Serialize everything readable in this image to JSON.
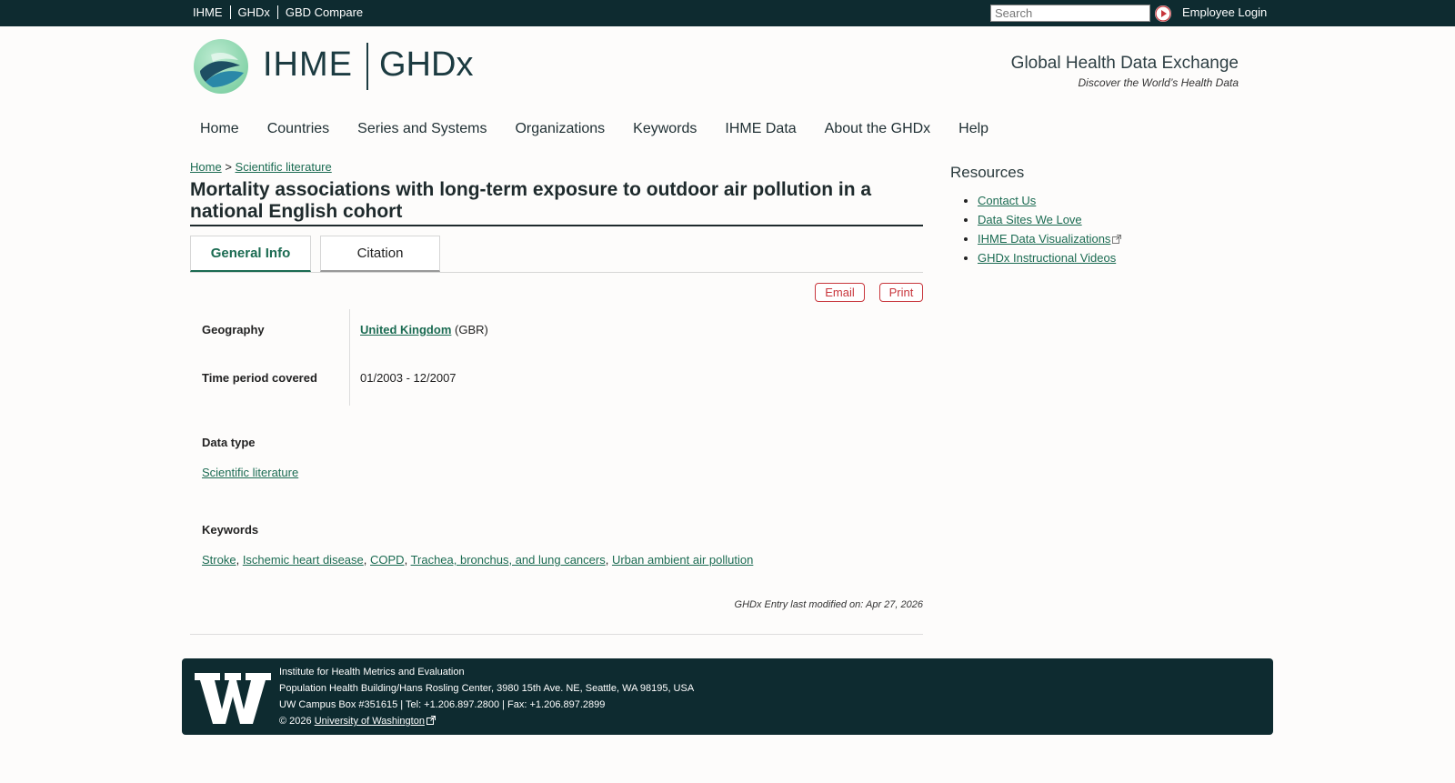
{
  "topbar": {
    "links": [
      "IHME",
      "GHDx",
      "GBD Compare"
    ],
    "search_placeholder": "Search",
    "employee_login": "Employee Login"
  },
  "header": {
    "brand_left": "IHME",
    "brand_right": "GHDx",
    "tagline_title": "Global Health Data Exchange",
    "tagline_sub": "Discover the World’s Health Data"
  },
  "nav": [
    "Home",
    "Countries",
    "Series and Systems",
    "Organizations",
    "Keywords",
    "IHME Data",
    "About the GHDx",
    "Help"
  ],
  "breadcrumb": {
    "home": "Home",
    "sep": ">",
    "current": "Scientific literature"
  },
  "title": "Mortality associations with long-term exposure to outdoor air pollution in a national English cohort",
  "tabs": {
    "general": "General Info",
    "citation": "Citation"
  },
  "actions": {
    "email": "Email",
    "print": "Print"
  },
  "info": {
    "geography_label": "Geography",
    "geography_link": "United Kingdom",
    "geography_code": "(GBR)",
    "time_label": "Time period covered",
    "time_value": "01/2003 - 12/2007",
    "datatype_label": "Data type",
    "datatype_value": "Scientific literature",
    "keywords_label": "Keywords",
    "keywords": [
      "Stroke",
      "Ischemic heart disease",
      "COPD",
      "Trachea, bronchus, and lung cancers",
      "Urban ambient air pollution"
    ]
  },
  "modified": "GHDx Entry last modified on: Apr 27, 2026",
  "resources": {
    "title": "Resources",
    "items": [
      "Contact Us",
      "Data Sites We Love",
      "IHME Data Visualizations",
      "GHDx Instructional Videos"
    ]
  },
  "footer": {
    "line1": "Institute for Health Metrics and Evaluation",
    "line2": "Population Health Building/Hans Rosling Center, 3980 15th Ave. NE, Seattle, WA 98195, USA",
    "line3": "UW Campus Box #351615 | Tel: +1.206.897.2800 | Fax: +1.206.897.2899",
    "copyright": "© 2026",
    "uw_link": "University of Washington"
  },
  "colors": {
    "topbar": "#0e2b30",
    "link": "#1b6b52",
    "action": "#c8363c"
  }
}
